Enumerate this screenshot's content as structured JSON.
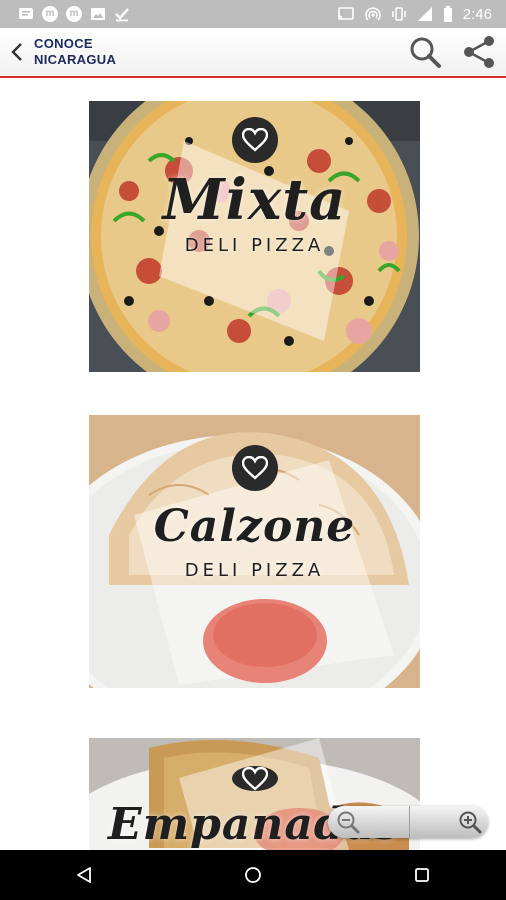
{
  "status_bar": {
    "time": "2:46",
    "left_icons": [
      "message-icon",
      "m-app-icon",
      "m-app-icon",
      "image-icon",
      "check-icon"
    ],
    "right_icons": [
      "cast-icon",
      "hotspot-icon",
      "vibrate-icon",
      "signal-icon",
      "battery-icon"
    ],
    "notif_letter": "m"
  },
  "app_bar": {
    "title_line1": "CONOCE",
    "title_line2": "NICARAGUA",
    "accent": "#d32f2f",
    "title_color": "#1a2b5e"
  },
  "cards": [
    {
      "title": "Mixta",
      "subtitle": "DELI PIZZA"
    },
    {
      "title": "Calzone",
      "subtitle": "DELI PIZZA"
    },
    {
      "title": "Empanadas",
      "subtitle": ""
    }
  ],
  "zoom": {
    "out_icon": "zoom-out-icon",
    "in_icon": "zoom-in-icon"
  },
  "nav": {
    "back": "back-triangle-icon",
    "home": "home-circle-icon",
    "recents": "recents-square-icon"
  }
}
